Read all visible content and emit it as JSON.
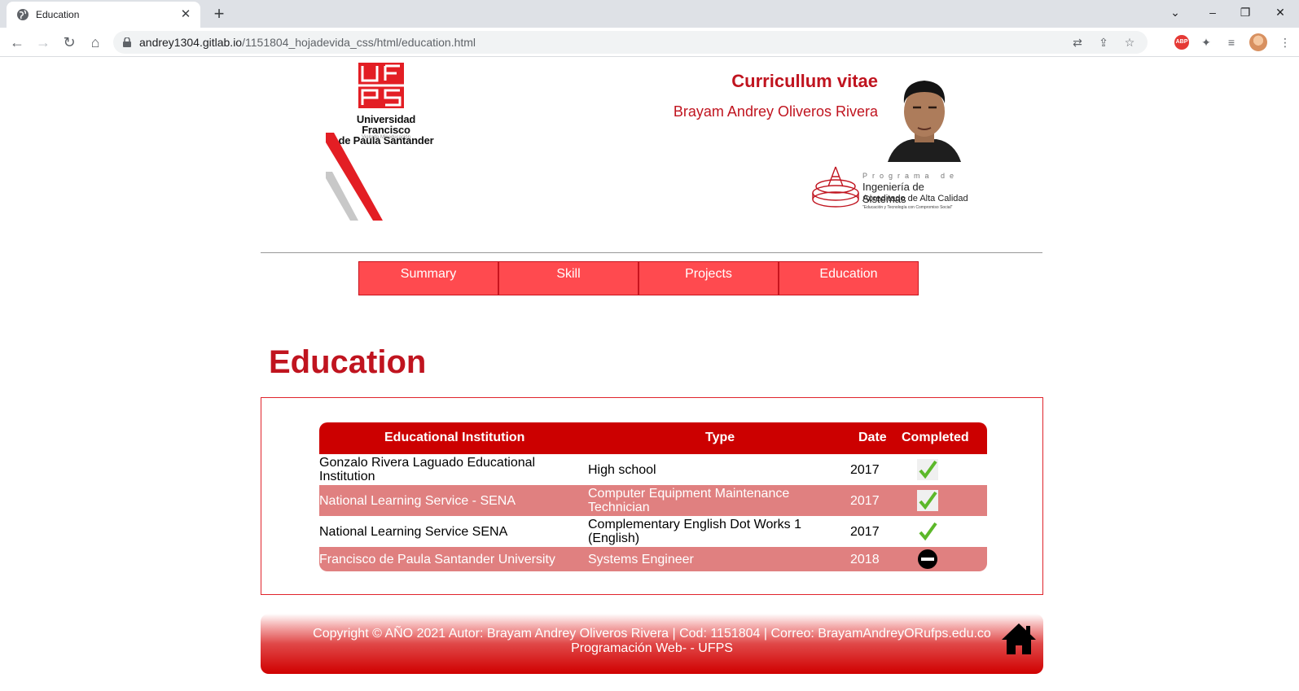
{
  "browser": {
    "tab_title": "Education",
    "new_tab": "+",
    "tab_close": "✕",
    "url_host": "andrey1304.gitlab.io",
    "url_path": "/1151804_hojadevida_css/html/education.html",
    "abp_label": "ABP"
  },
  "header": {
    "university_line1": "Universidad Francisco",
    "university_line2": "de Paula Santander",
    "university_sub": "Vigilada Mineducación",
    "cv_title": "Curricullum vitae",
    "cv_name": "Brayam Andrey Oliveros Rivera",
    "program_top": "Programa de",
    "program_name": "Ingeniería de Sistemas",
    "program_accredited": "Acreditado de Alta Calidad",
    "program_motto": "\"Educación y Tecnología con Compromiso Social\""
  },
  "nav": {
    "items": [
      {
        "label": "Summary"
      },
      {
        "label": "Skill"
      },
      {
        "label": "Projects"
      },
      {
        "label": "Education"
      }
    ]
  },
  "main": {
    "title": "Education",
    "table": {
      "headers": [
        "Educational Institution",
        "Type",
        "Date",
        "Completed"
      ],
      "rows": [
        {
          "institution_l1": "Gonzalo Rivera Laguado Educational",
          "institution_l2": "Institution",
          "type_l1": "High school",
          "type_l2": "",
          "date": "2017",
          "completed": true
        },
        {
          "institution_l1": "National Learning Service - SENA",
          "institution_l2": "",
          "type_l1": "Computer Equipment Maintenance",
          "type_l2": "Technician",
          "date": "2017",
          "completed": true
        },
        {
          "institution_l1": "National Learning Service SENA",
          "institution_l2": "",
          "type_l1": "Complementary English Dot Works 1",
          "type_l2": "(English)",
          "date": "2017",
          "completed": true
        },
        {
          "institution_l1": "Francisco de Paula Santander University",
          "institution_l2": "",
          "type_l1": "Systems Engineer",
          "type_l2": "",
          "date": "2018",
          "completed": false
        }
      ]
    }
  },
  "footer": {
    "line1": "Copyright © AÑO 2021 Autor: Brayam Andrey Oliveros Rivera | Cod: 1151804 | Correo: BrayamAndreyORufps.edu.co",
    "line2": "Programación Web- - UFPS"
  },
  "colors": {
    "brand_red": "#c0141f",
    "nav_red": "#ff4a4f",
    "table_header": "#cc0000",
    "table_alt_row": "#e08080",
    "check_green": "#5cb82a"
  }
}
